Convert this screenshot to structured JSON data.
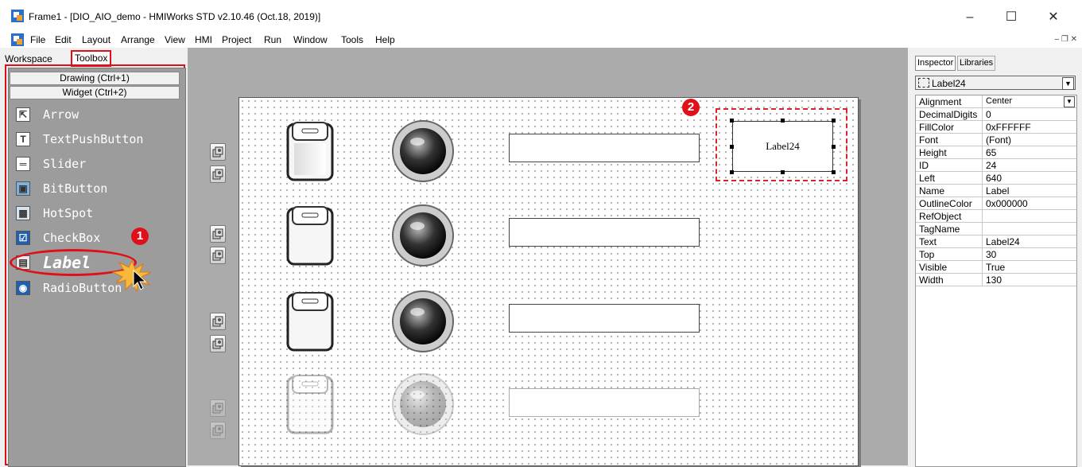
{
  "window": {
    "title": "Frame1 - [DIO_AIO_demo - HMIWorks STD v2.10.46 (Oct.18, 2019)]",
    "controls": [
      "–",
      "☐",
      "✕"
    ],
    "mdi_controls": "– ❐ ✕"
  },
  "menu": [
    "File",
    "Edit",
    "Layout",
    "Arrange",
    "View",
    "HMI",
    "Project",
    "Run",
    "Window",
    "Tools",
    "Help"
  ],
  "left_pane": {
    "tabs": [
      "Workspace",
      "Toolbox"
    ],
    "active_tab": "Toolbox",
    "categories": [
      "Drawing (Ctrl+1)",
      "Widget (Ctrl+2)"
    ],
    "tools": [
      {
        "label": "Arrow",
        "icon": "arrow-icon"
      },
      {
        "label": "TextPushButton",
        "icon": "text-push-button-icon"
      },
      {
        "label": "Slider",
        "icon": "slider-icon"
      },
      {
        "label": "BitButton",
        "icon": "bit-button-icon"
      },
      {
        "label": "HotSpot",
        "icon": "hotspot-icon"
      },
      {
        "label": "CheckBox",
        "icon": "checkbox-icon"
      },
      {
        "label": "Label",
        "icon": "label-icon"
      },
      {
        "label": "RadioButton",
        "icon": "radio-button-icon"
      }
    ]
  },
  "design": {
    "selected_label_text": "Label24"
  },
  "annotations": {
    "badge1": "1",
    "badge2": "2"
  },
  "right_pane": {
    "tabs": [
      "Inspector",
      "Libraries"
    ],
    "active_tab": "Inspector",
    "selected_object": "Label24",
    "properties": [
      {
        "name": "Alignment",
        "value": "Center"
      },
      {
        "name": "DecimalDigits",
        "value": "0"
      },
      {
        "name": "FillColor",
        "value": "0xFFFFFF"
      },
      {
        "name": "Font",
        "value": "(Font)"
      },
      {
        "name": "Height",
        "value": "65"
      },
      {
        "name": "ID",
        "value": "24"
      },
      {
        "name": "Left",
        "value": "640"
      },
      {
        "name": "Name",
        "value": "Label"
      },
      {
        "name": "OutlineColor",
        "value": "0x000000"
      },
      {
        "name": "RefObject",
        "value": ""
      },
      {
        "name": "TagName",
        "value": ""
      },
      {
        "name": "Text",
        "value": "Label24"
      },
      {
        "name": "Top",
        "value": "30"
      },
      {
        "name": "Visible",
        "value": "True"
      },
      {
        "name": "Width",
        "value": "130"
      }
    ]
  },
  "colors": {
    "highlight": "#e0101a",
    "toolbox_bg": "#9c9c9c",
    "design_bg": "#ababab"
  }
}
